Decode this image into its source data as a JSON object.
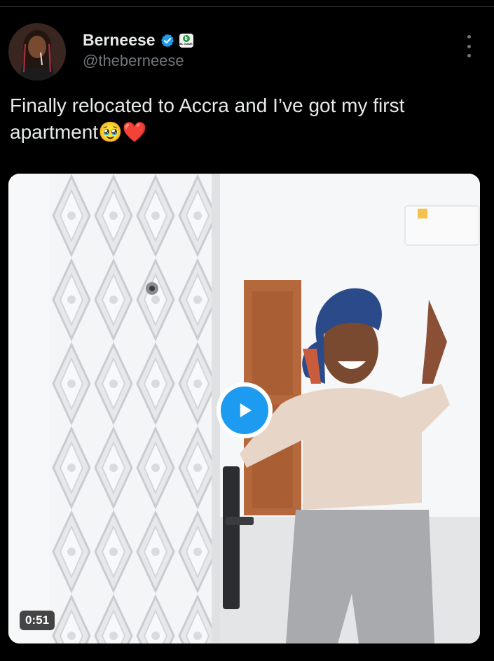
{
  "author": {
    "display_name": "Berneese",
    "handle": "@theberneese",
    "affiliate_badge_text": "BL GAME",
    "verified_icon": "verified-check-icon"
  },
  "tweet": {
    "text": "Finally relocated to Accra and I’ve got my first apartment🥹❤️"
  },
  "media": {
    "type": "video",
    "duration": "0:51",
    "play_icon": "play-icon"
  },
  "colors": {
    "background": "#000000",
    "accent": "#1d9bf0",
    "secondary_text": "#71767b",
    "primary_text": "#e7e9ea"
  }
}
